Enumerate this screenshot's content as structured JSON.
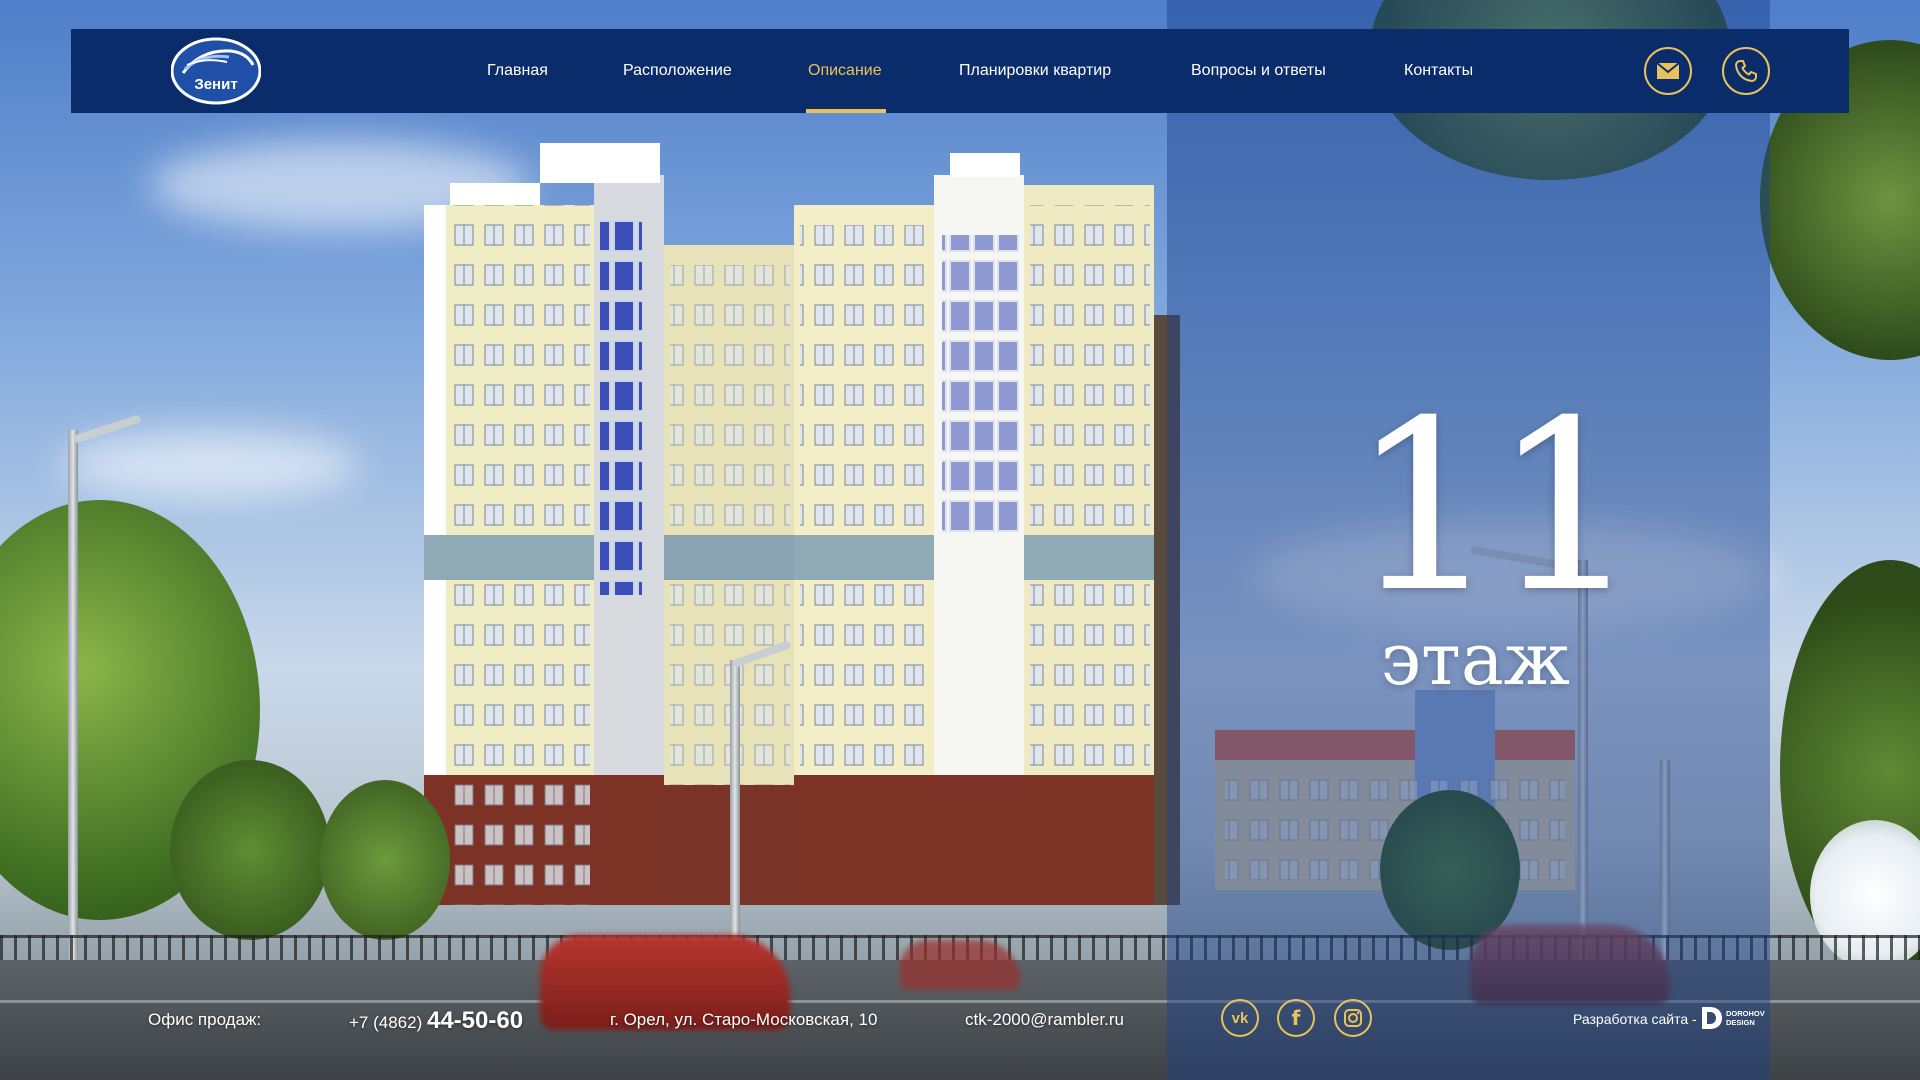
{
  "nav": {
    "logo_text": "Зенит",
    "items": [
      {
        "label": "Главная",
        "active": false
      },
      {
        "label": "Расположение",
        "active": false
      },
      {
        "label": "Описание",
        "active": true
      },
      {
        "label": "Планировки квартир",
        "active": false
      },
      {
        "label": "Вопросы и ответы",
        "active": false
      },
      {
        "label": "Контакты",
        "active": false
      }
    ],
    "mail_icon": "mail-icon",
    "phone_icon": "phone-icon"
  },
  "hero": {
    "floors_number": "11",
    "floors_label": "этаж"
  },
  "footer": {
    "office_label": "Офис продаж:",
    "phone_prefix": "+7 (4862)",
    "phone_main": "44-50-60",
    "address": "г. Орел, ул. Старо-Московская, 10",
    "email": "ctk-2000@rambler.ru",
    "socials": [
      "vk-icon",
      "facebook-icon",
      "instagram-icon"
    ],
    "dev_label": "Разработка сайта -",
    "dev_logo_text": "DOROHOV DESIGN"
  },
  "colors": {
    "navbar": "#0a2c6a",
    "accent": "#e9c35a",
    "overlay": "#1b408c"
  }
}
